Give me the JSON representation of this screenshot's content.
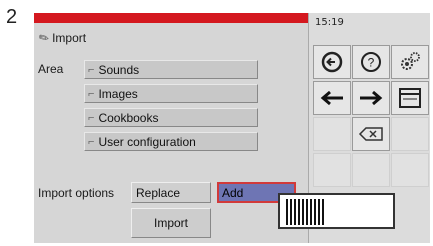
{
  "step_number": "2",
  "header": {
    "title": "Import",
    "time": "15:19"
  },
  "area": {
    "label": "Area",
    "items": [
      {
        "label": "Sounds"
      },
      {
        "label": "Images"
      },
      {
        "label": "Cookbooks"
      },
      {
        "label": "User configuration"
      }
    ]
  },
  "import_options": {
    "label": "Import options",
    "replace_label": "Replace",
    "add_label": "Add",
    "selected": "Add"
  },
  "import_button": {
    "label": "Import"
  },
  "colors": {
    "header_bar": "#d4181f",
    "selected_option": "#6e75b4",
    "selected_border": "#d23a3a"
  },
  "side_icons": [
    "back-icon",
    "help-icon",
    "settings-icon",
    "arrow-left-icon",
    "arrow-right-icon",
    "window-icon",
    "backspace-icon"
  ]
}
